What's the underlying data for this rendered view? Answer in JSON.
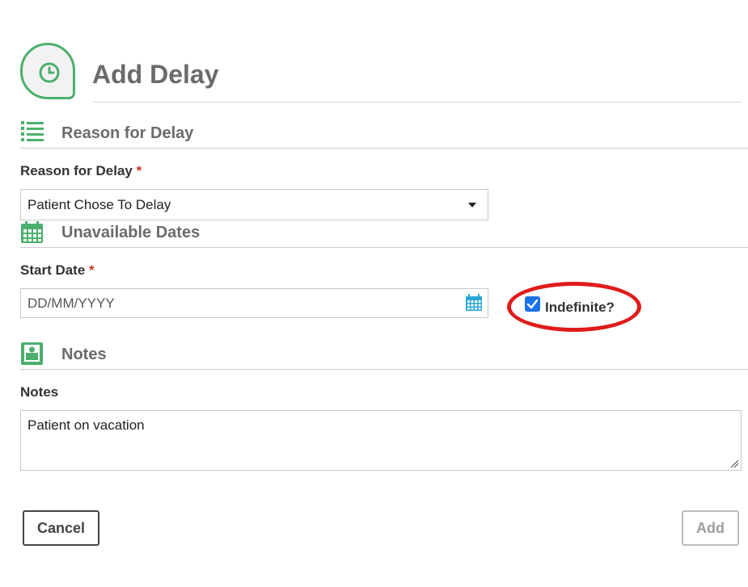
{
  "header": {
    "title": "Add Delay",
    "icon": "clock-icon",
    "accent": "#4caf6e"
  },
  "sections": {
    "reason": {
      "title": "Reason for Delay",
      "icon": "list-icon"
    },
    "dates": {
      "title": "Unavailable Dates",
      "icon": "calendar-icon"
    },
    "notes": {
      "title": "Notes",
      "icon": "notes-icon"
    }
  },
  "fields": {
    "reason": {
      "label": "Reason for Delay",
      "required_mark": "*",
      "value": "Patient Chose To Delay"
    },
    "start_date": {
      "label": "Start Date",
      "required_mark": "*",
      "placeholder": "DD/MM/YYYY"
    },
    "indefinite": {
      "label": "Indefinite?",
      "checked": true
    },
    "notes": {
      "label": "Notes",
      "value": "Patient on vacation"
    }
  },
  "buttons": {
    "cancel": "Cancel",
    "add": "Add"
  },
  "colors": {
    "required": "#c0392b",
    "highlight": "#e01b1b",
    "checkbox": "#1a73e8",
    "calendar_input_icon": "#29a8d8"
  }
}
